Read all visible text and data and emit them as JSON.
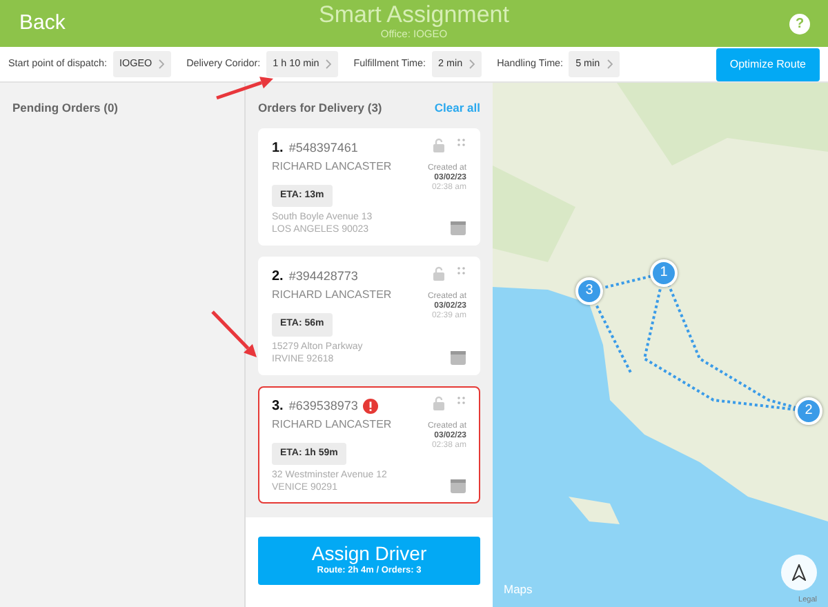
{
  "header": {
    "back": "Back",
    "title": "Smart Assignment",
    "subtitle": "Office: IOGEO",
    "help": "?"
  },
  "settings": [
    {
      "label": "Start point of dispatch:",
      "value": "IOGEO"
    },
    {
      "label": "Delivery Coridor:",
      "value": "1 h 10 min"
    },
    {
      "label": "Fulfillment Time:",
      "value": "2 min"
    },
    {
      "label": "Handling Time:",
      "value": "5 min"
    }
  ],
  "optimize_button": "Optimize Route",
  "pending": {
    "title": "Pending Orders (0)"
  },
  "delivery": {
    "title": "Orders for Delivery (3)",
    "clear": "Clear all"
  },
  "orders": [
    {
      "index": "1.",
      "number": "#548397461",
      "customer": "RICHARD LANCASTER",
      "eta": "ETA: 13m",
      "created_label": "Created at",
      "date": "03/02/23",
      "time": "02:38 am",
      "street": "South Boyle Avenue 13",
      "city": "LOS ANGELES 90023",
      "warning": false
    },
    {
      "index": "2.",
      "number": "#394428773",
      "customer": "RICHARD LANCASTER",
      "eta": "ETA: 56m",
      "created_label": "Created at",
      "date": "03/02/23",
      "time": "02:39 am",
      "street": "15279 Alton Parkway",
      "city": "IRVINE 92618",
      "warning": false
    },
    {
      "index": "3.",
      "number": "#639538973",
      "customer": "RICHARD LANCASTER",
      "eta": "ETA: 1h 59m",
      "created_label": "Created at",
      "date": "03/02/23",
      "time": "02:38 am",
      "street": "32 Westminster Avenue 12",
      "city": "VENICE 90291",
      "warning": true
    }
  ],
  "assign": {
    "label": "Assign Driver",
    "sub": "Route: 2h 4m / Orders: 3"
  },
  "map": {
    "pins": [
      "1",
      "2",
      "3"
    ],
    "logo": "Maps",
    "legal": "Legal"
  }
}
